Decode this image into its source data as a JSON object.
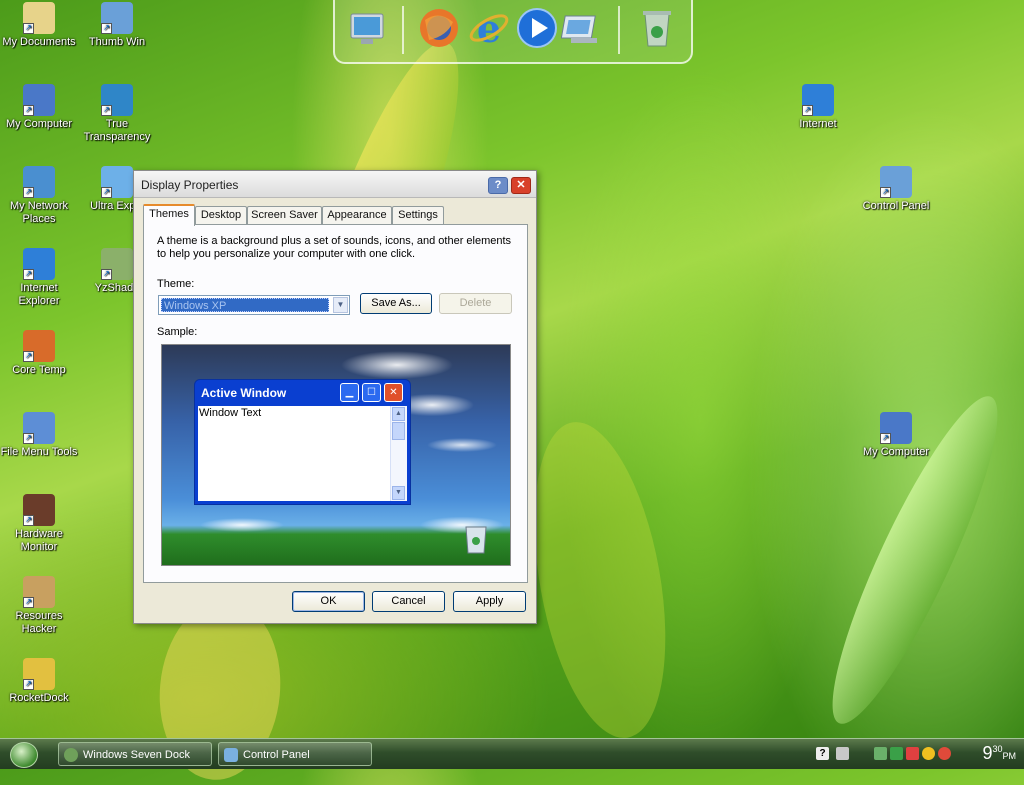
{
  "desktop_icons": [
    {
      "label": "My Documents",
      "icon": "my-documents-icon",
      "color": "#e7d38a"
    },
    {
      "label": "Thumb Win",
      "icon": "thumb-win-icon",
      "color": "#6aa0d8"
    },
    {
      "label": "My Computer",
      "icon": "my-computer-icon",
      "color": "#4a78c8"
    },
    {
      "label": "True Transparency",
      "icon": "true-transparency-icon",
      "color": "#2f86c8"
    },
    {
      "label": "My Network Places",
      "icon": "network-places-icon",
      "color": "#4a8fd0"
    },
    {
      "label": "Ultra Explo",
      "icon": "ultra-explorer-icon",
      "color": "#6db0e8"
    },
    {
      "label": "Internet Explorer",
      "icon": "internet-explorer-icon",
      "color": "#2e7fd8"
    },
    {
      "label": "YzShado",
      "icon": "yzshadow-icon",
      "color": "#8bb06a"
    },
    {
      "label": "Core Temp",
      "icon": "core-temp-icon",
      "color": "#d86b2a"
    },
    {
      "label": "File Menu Tools",
      "icon": "file-menu-tools-icon",
      "color": "#5d8ed6"
    },
    {
      "label": "Hardware Monitor",
      "icon": "hardware-monitor-icon",
      "color": "#6a3c2a"
    },
    {
      "label": "Resoures Hacker",
      "icon": "resource-hacker-icon",
      "color": "#c8a060"
    },
    {
      "label": "RocketDock",
      "icon": "rocketdock-icon",
      "color": "#e2c040"
    },
    {
      "label": "Internet",
      "icon": "internet-icon",
      "color": "#2e7fd8"
    },
    {
      "label": "Control Panel",
      "icon": "control-panel-icon",
      "color": "#6aa0d8"
    },
    {
      "label": "My Computer",
      "icon": "my-computer-icon",
      "color": "#4a78c8"
    }
  ],
  "dock": {
    "items": [
      "monitor-icon",
      "firefox-icon",
      "internet-explorer-icon",
      "media-player-icon",
      "control-panel-icon",
      "recycle-bin-icon"
    ]
  },
  "dialog": {
    "title": "Display Properties",
    "help_label": "?",
    "close_label": "✕",
    "tabs": [
      "Themes",
      "Desktop",
      "Screen Saver",
      "Appearance",
      "Settings"
    ],
    "description": "A theme is a background plus a set of sounds, icons, and other elements to help you personalize your computer with one click.",
    "theme_label": "Theme:",
    "theme_value": "Windows XP",
    "save_as_label": "Save As...",
    "delete_label": "Delete",
    "sample_label": "Sample:",
    "sample": {
      "window_title": "Active Window",
      "window_text": "Window Text"
    },
    "ok_label": "OK",
    "cancel_label": "Cancel",
    "apply_label": "Apply"
  },
  "taskbar": {
    "tasks": [
      {
        "label": "Windows Seven Dock"
      },
      {
        "label": "Control Panel"
      }
    ],
    "clock": {
      "hour": "9",
      "minutes": "30",
      "ampm": "PM"
    }
  }
}
